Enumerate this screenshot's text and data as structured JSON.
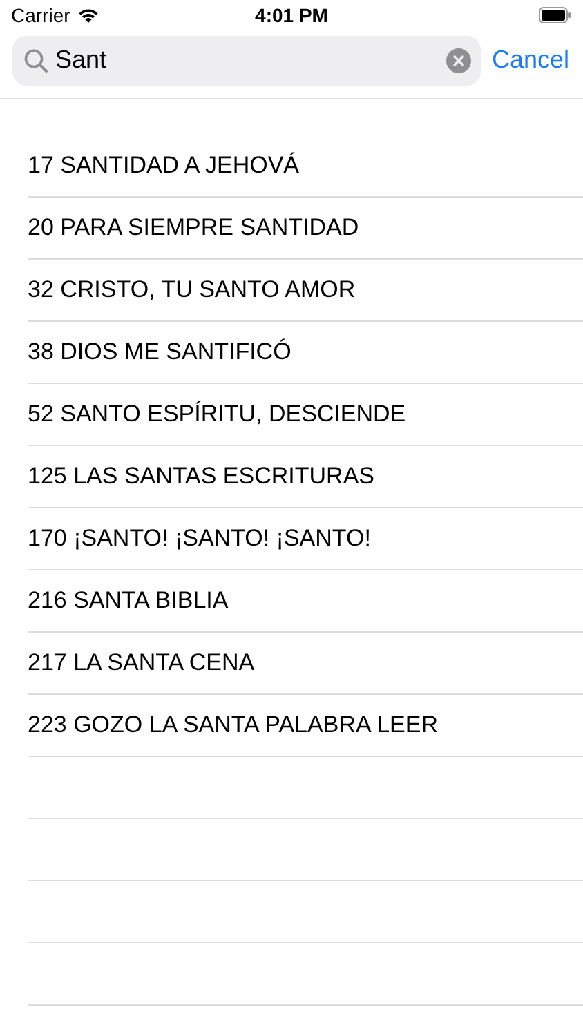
{
  "status_bar": {
    "carrier": "Carrier",
    "time": "4:01 PM"
  },
  "search": {
    "value": "Sant"
  },
  "cancel_button": "Cancel",
  "results": [
    "17 SANTIDAD A JEHOVÁ",
    "20 PARA SIEMPRE SANTIDAD",
    "32 CRISTO, TU SANTO AMOR",
    "38 DIOS ME SANTIFICÓ",
    "52 SANTO ESPÍRITU, DESCIENDE",
    "125 LAS SANTAS ESCRITURAS",
    "170 ¡SANTO! ¡SANTO! ¡SANTO!",
    "216 SANTA BIBLIA",
    "217 LA SANTA CENA",
    "223 GOZO LA SANTA PALABRA LEER"
  ]
}
